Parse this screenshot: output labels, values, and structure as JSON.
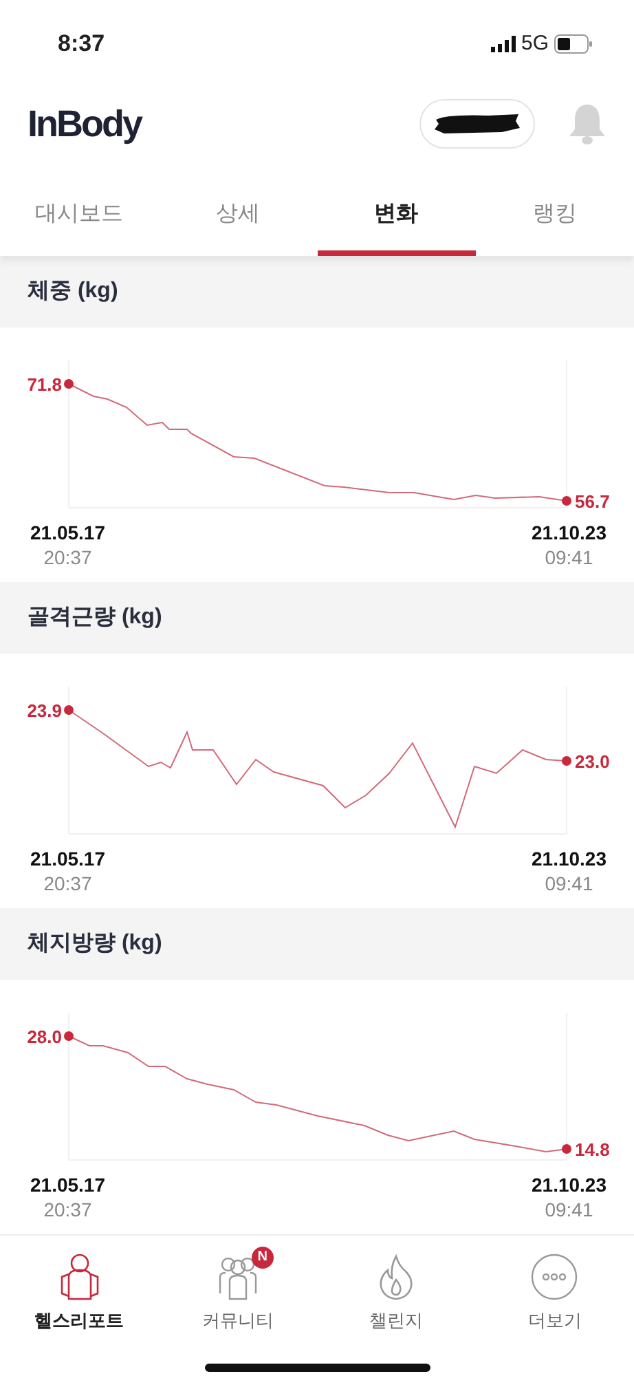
{
  "status_bar": {
    "time": "8:37",
    "network": "5G"
  },
  "header": {
    "logo": "InBody"
  },
  "tabs": [
    {
      "label": "대시보드",
      "selected": false
    },
    {
      "label": "상세",
      "selected": false
    },
    {
      "label": "변화",
      "selected": true
    },
    {
      "label": "랭킹",
      "selected": false
    }
  ],
  "sections": [
    {
      "title": "체중 (kg)",
      "start_value": "71.8",
      "end_value": "56.7",
      "start_date": "21.05.17",
      "start_time": "20:37",
      "end_date": "21.10.23",
      "end_time": "09:41"
    },
    {
      "title": "골격근량 (kg)",
      "start_value": "23.9",
      "end_value": "23.0",
      "start_date": "21.05.17",
      "start_time": "20:37",
      "end_date": "21.10.23",
      "end_time": "09:41"
    },
    {
      "title": "체지방량 (kg)",
      "start_value": "28.0",
      "end_value": "14.8",
      "start_date": "21.05.17",
      "start_time": "20:37",
      "end_date": "21.10.23",
      "end_time": "09:41"
    }
  ],
  "bottom_nav": [
    {
      "label": "헬스리포트",
      "selected": true
    },
    {
      "label": "커뮤니티",
      "selected": false,
      "badge": "N"
    },
    {
      "label": "챌린지",
      "selected": false
    },
    {
      "label": "더보기",
      "selected": false
    }
  ]
}
